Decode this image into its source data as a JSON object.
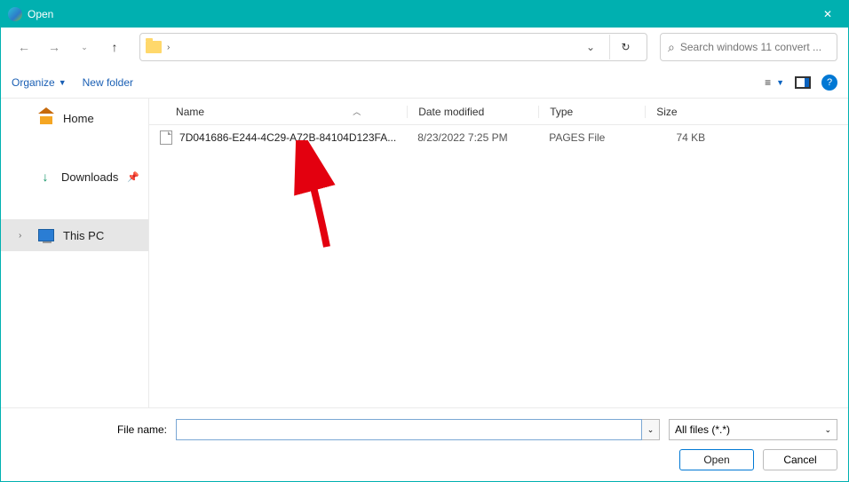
{
  "window": {
    "title": "Open"
  },
  "nav": {
    "search_placeholder": "Search windows 11 convert ..."
  },
  "toolbar": {
    "organize_label": "Organize",
    "newfolder_label": "New folder"
  },
  "sidebar": {
    "items": [
      {
        "label": "Home"
      },
      {
        "label": "Downloads"
      },
      {
        "label": "This PC"
      }
    ]
  },
  "columns": {
    "name": "Name",
    "date": "Date modified",
    "type": "Type",
    "size": "Size"
  },
  "files": [
    {
      "name": "7D041686-E244-4C29-A72B-84104D123FA...",
      "date": "8/23/2022 7:25 PM",
      "type": "PAGES File",
      "size": "74 KB"
    }
  ],
  "footer": {
    "filename_label": "File name:",
    "filename_value": "",
    "filter_label": "All files (*.*)",
    "open_label": "Open",
    "cancel_label": "Cancel"
  }
}
